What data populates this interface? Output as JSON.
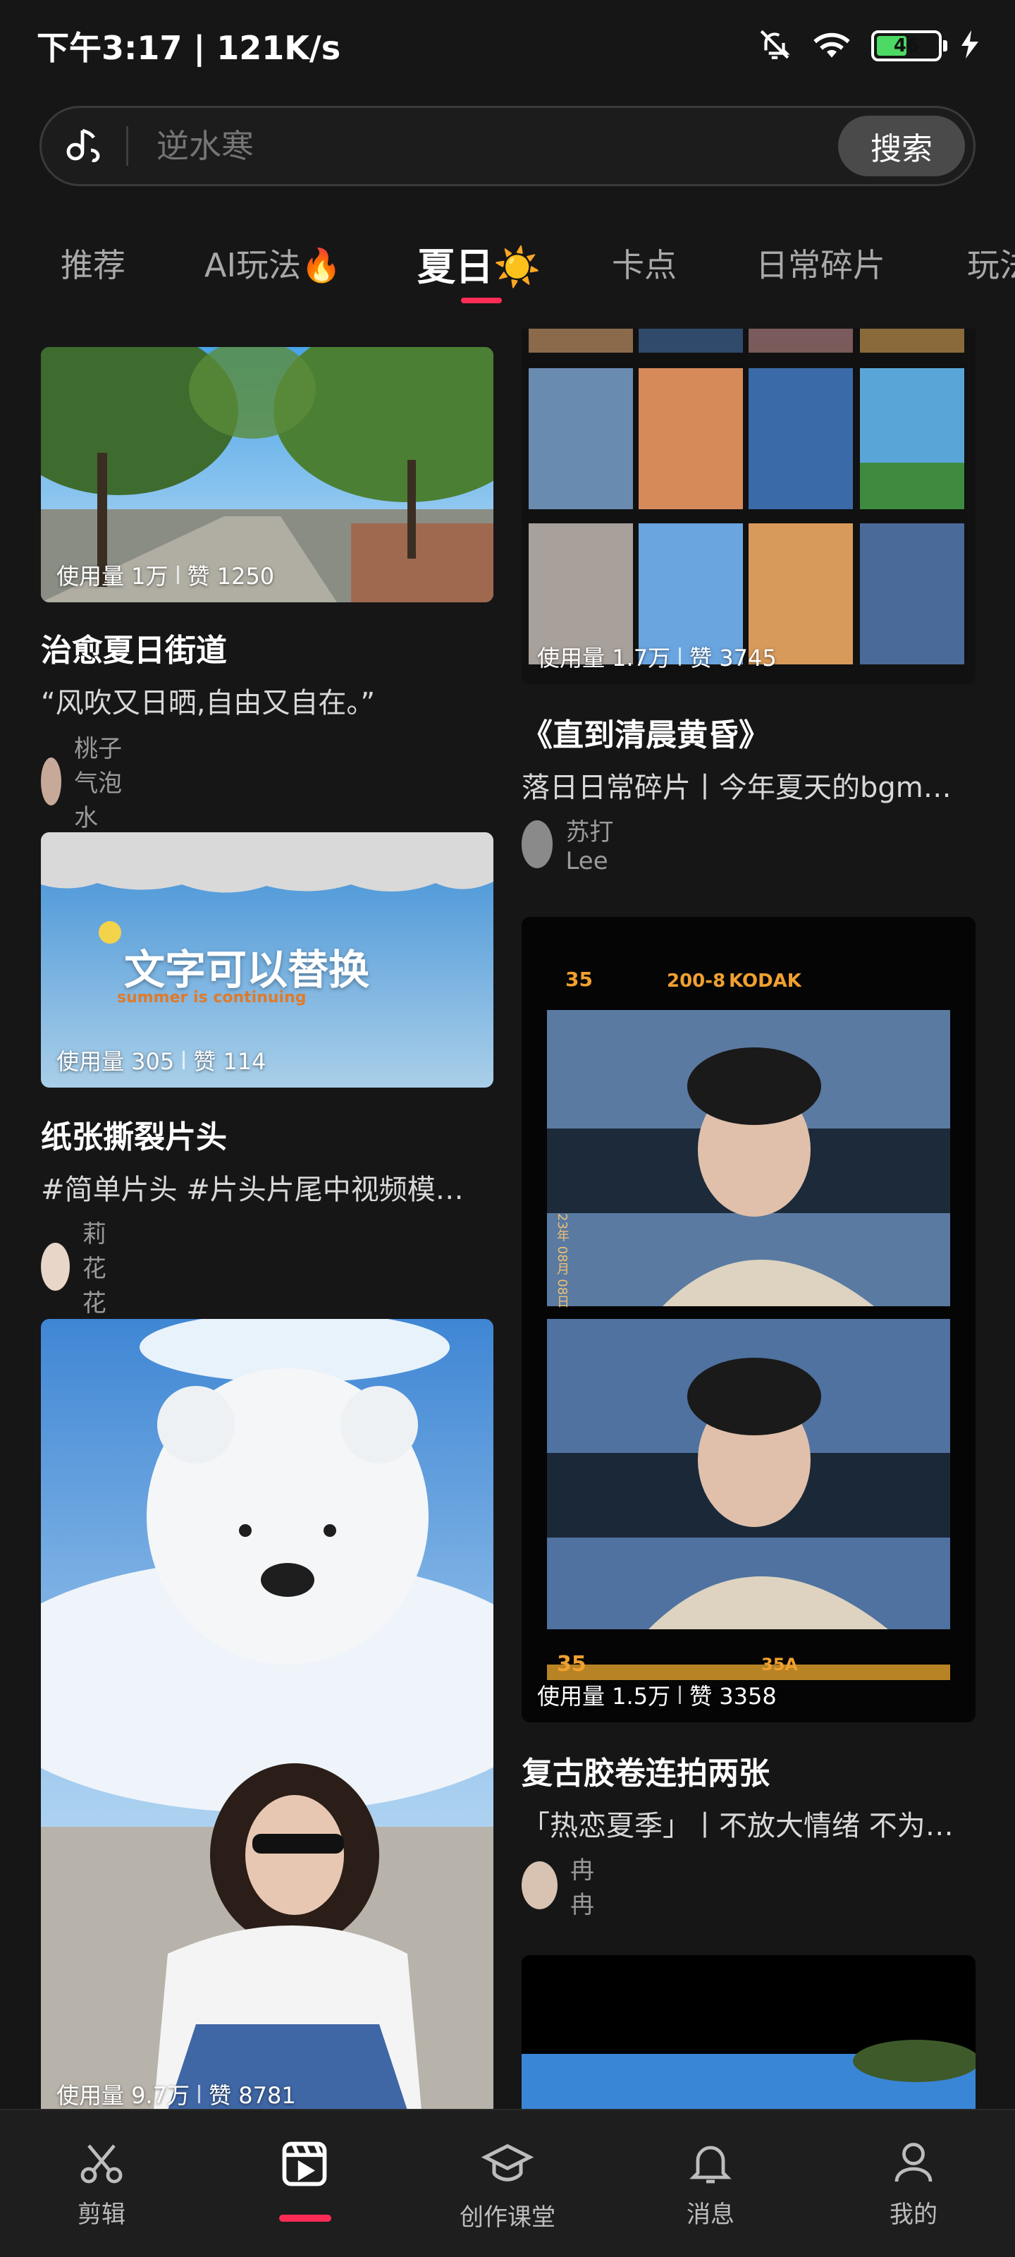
{
  "status": {
    "time_speed": "下午3:17 | 121K/s",
    "battery_level": "46"
  },
  "search": {
    "placeholder": "逆水寒",
    "button_label": "搜索"
  },
  "tabs": [
    {
      "label": "推荐"
    },
    {
      "label": "AI玩法🔥"
    },
    {
      "label": "夏日☀️"
    },
    {
      "label": "卡点"
    },
    {
      "label": "日常碎片"
    },
    {
      "label": "玩法"
    }
  ],
  "cards": {
    "left": [
      {
        "stats_usage": "使用量 1万",
        "stats_likes": "赞 1250",
        "title": "治愈夏日街道",
        "desc": "“风吹又日晒,自由又自在。”",
        "author": "桃子气泡水"
      },
      {
        "stats_usage": "使用量 305",
        "stats_likes": "赞 114",
        "title": "纸张撕裂片头",
        "desc": "#简单片头 #片头片尾中视频模…",
        "author": "莉花花",
        "overlay_text": "文字可以替换",
        "overlay_sub": "summer is continuing"
      },
      {
        "stats_usage": "使用量 9.7万",
        "stats_likes": "赞 8781"
      }
    ],
    "right": [
      {
        "stats_usage": "使用量 1.7万",
        "stats_likes": "赞 3745",
        "title": "《直到清晨黄昏》",
        "desc": "落日日常碎片丨今年夏天的bgm…",
        "author": "苏打Lee"
      },
      {
        "stats_usage": "使用量 1.5万",
        "stats_likes": "赞 3358",
        "title": "复古胶卷连拍两张",
        "desc": "「热恋夏季」丨不放大情绪 不为…",
        "author": "冉冉",
        "film_top_left": "35",
        "film_top_code": "200-8",
        "film_brand": "KODAK",
        "film_bottom_left": "35",
        "film_bottom_mid": "35A",
        "date_stamp": "23年 08月 08日"
      }
    ]
  },
  "nav": [
    {
      "label": "剪辑"
    },
    {
      "label": ""
    },
    {
      "label": "创作课堂"
    },
    {
      "label": "消息"
    },
    {
      "label": "我的"
    }
  ],
  "colors": {
    "accent": "#fe2c55",
    "background": "#161616"
  }
}
